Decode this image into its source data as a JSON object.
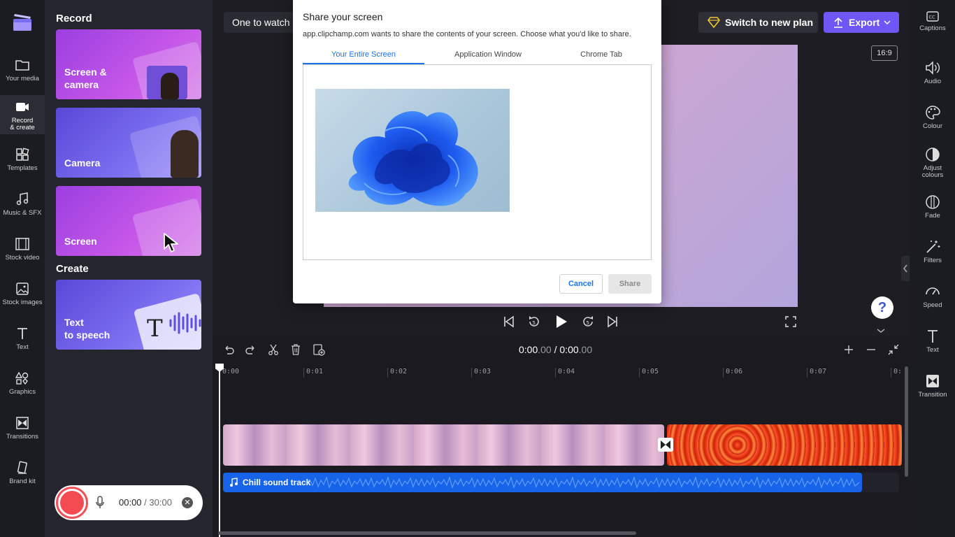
{
  "left_nav": {
    "items": [
      {
        "label": "Your media",
        "icon": "folder-icon"
      },
      {
        "label": "Record\n& create",
        "icon": "video-camera-icon",
        "active": true
      },
      {
        "label": "Templates",
        "icon": "templates-icon"
      },
      {
        "label": "Music & SFX",
        "icon": "music-icon"
      },
      {
        "label": "Stock video",
        "icon": "film-icon"
      },
      {
        "label": "Stock images",
        "icon": "image-icon"
      },
      {
        "label": "Text",
        "icon": "text-icon"
      },
      {
        "label": "Graphics",
        "icon": "graphics-icon"
      },
      {
        "label": "Transitions",
        "icon": "transitions-icon"
      },
      {
        "label": "Brand kit",
        "icon": "brand-kit-icon"
      }
    ]
  },
  "panel": {
    "record_title": "Record",
    "create_title": "Create",
    "cards": [
      {
        "label": "Screen &\ncamera"
      },
      {
        "label": "Camera"
      },
      {
        "label": "Screen"
      },
      {
        "label": "Text\nto speech"
      }
    ],
    "recorder": {
      "elapsed": "00:00",
      "separator": " / ",
      "limit": "30:00"
    }
  },
  "header": {
    "project_title": "One to watch",
    "switch_plan_label": "Switch to new plan",
    "export_label": "Export",
    "aspect_ratio": "16:9"
  },
  "right_rail": {
    "items": [
      {
        "label": "Captions",
        "icon": "captions-icon"
      },
      {
        "label": "Audio",
        "icon": "speaker-icon"
      },
      {
        "label": "Colour",
        "icon": "palette-icon"
      },
      {
        "label": "Adjust\ncolours",
        "icon": "contrast-icon"
      },
      {
        "label": "Fade",
        "icon": "fade-icon"
      },
      {
        "label": "Filters",
        "icon": "magic-wand-icon"
      },
      {
        "label": "Speed",
        "icon": "speedometer-icon"
      },
      {
        "label": "Text",
        "icon": "text-icon"
      },
      {
        "label": "Transition",
        "icon": "transition-icon"
      }
    ]
  },
  "timeline": {
    "current_time": "0:00",
    "current_frac": ".00",
    "separator": " / ",
    "total_time": "0:00",
    "total_frac": ".00",
    "ruler": [
      "0:00",
      "0:01",
      "0:02",
      "0:03",
      "0:04",
      "0:05",
      "0:06",
      "0:07",
      "0:"
    ],
    "audio_track_label": "Chill sound track"
  },
  "dialog": {
    "title": "Share your screen",
    "subtitle": "app.clipchamp.com wants to share the contents of your screen. Choose what you'd like to share.",
    "tabs": [
      "Your Entire Screen",
      "Application Window",
      "Chrome Tab"
    ],
    "active_tab": 0,
    "cancel_label": "Cancel",
    "share_label": "Share"
  },
  "colors": {
    "accent": "#6e57f5",
    "record_red": "#f44a52",
    "audio_blue": "#1864e8",
    "dialog_link": "#1a73e8"
  }
}
